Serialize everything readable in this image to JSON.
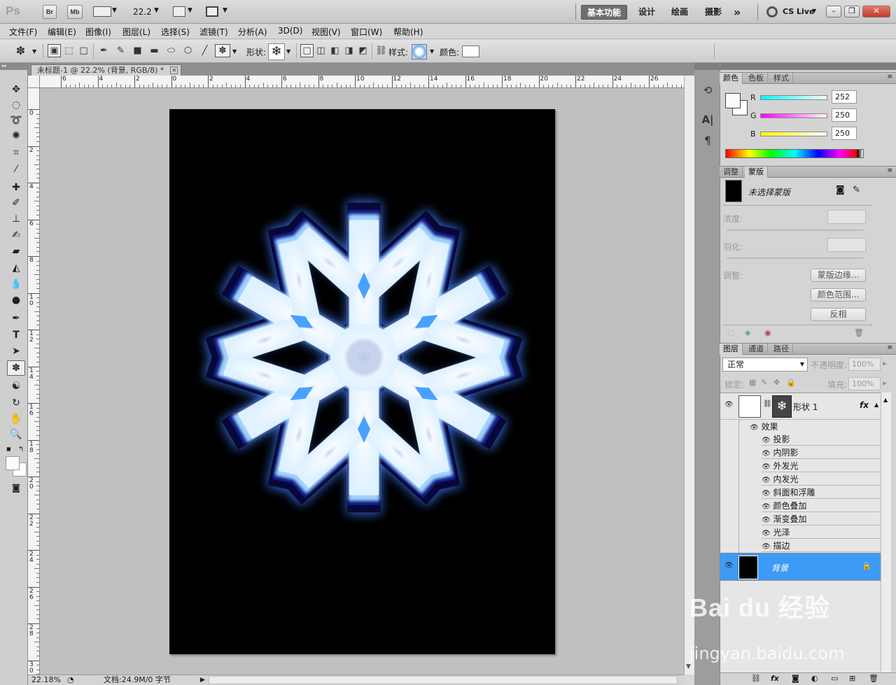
{
  "appbar": {
    "logo": "Ps",
    "br": "Br",
    "mb": "Mb",
    "zoom": "22.2",
    "workspaces": [
      "基本功能",
      "设计",
      "绘画",
      "摄影"
    ],
    "more": "»",
    "cslive": "CS Live"
  },
  "menu": [
    "文件(F)",
    "编辑(E)",
    "图像(I)",
    "图层(L)",
    "选择(S)",
    "滤镜(T)",
    "分析(A)",
    "3D(D)",
    "视图(V)",
    "窗口(W)",
    "帮助(H)"
  ],
  "options": {
    "shape_label": "形状:",
    "style_label": "样式:",
    "color_label": "颜色:"
  },
  "document": {
    "tab_title": "未标题-1 @ 22.2% (背景, RGB/8) *",
    "zoom_status": "22.18%",
    "doc_status": "文档:24.9M/0 字节"
  },
  "rulers": {
    "h": [
      "6",
      "4",
      "2",
      "0",
      "2",
      "4",
      "6",
      "8",
      "10",
      "12",
      "14",
      "16",
      "18",
      "20",
      "22",
      "24",
      "26"
    ],
    "v": [
      "0",
      "2",
      "4",
      "6",
      "8",
      "10",
      "12",
      "14",
      "16",
      "18",
      "20",
      "22",
      "24",
      "26",
      "28",
      "30"
    ]
  },
  "color_panel": {
    "tabs": [
      "颜色",
      "色板",
      "样式"
    ],
    "r_label": "R",
    "g_label": "G",
    "b_label": "B",
    "r": "252",
    "g": "250",
    "b": "250"
  },
  "mask_panel": {
    "tabs": [
      "调整",
      "蒙版"
    ],
    "no_mask": "未选择蒙版",
    "density": "浓度:",
    "feather": "羽化:",
    "adjust": "调整:",
    "btn_edge": "蒙版边缘...",
    "btn_range": "颜色范围...",
    "btn_invert": "反相"
  },
  "layers_panel": {
    "tabs": [
      "图层",
      "通道",
      "路径"
    ],
    "blend_mode": "正常",
    "opacity_label": "不透明度:",
    "opacity": "100%",
    "lock_label": "锁定:",
    "fill_label": "填充:",
    "fill": "100%",
    "shape_layer": "形状 1",
    "fx": "fx",
    "effects_label": "效果",
    "effects": [
      "投影",
      "内阴影",
      "外发光",
      "内发光",
      "斜面和浮雕",
      "颜色叠加",
      "渐变叠加",
      "光泽",
      "描边"
    ],
    "bg_layer": "背景"
  },
  "watermark": {
    "brand": "Bai du 经验",
    "url": "jingyan.baidu.com"
  },
  "colors": {
    "accent_selected_layer": "#3d9bf5",
    "snowflake_fill": "#e8f6ff",
    "glow": "#4a8cff",
    "stroke": "#0a0a3a"
  }
}
